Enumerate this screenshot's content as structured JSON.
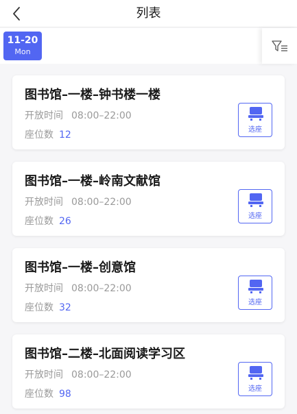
{
  "header": {
    "title": "列表",
    "back_icon": "chevron-left-icon"
  },
  "date_bar": {
    "selected_date": "11-20",
    "selected_weekday": "Mon",
    "accent_color": "#5266f2",
    "filter_icon": "filter-list-icon"
  },
  "labels": {
    "open_time": "开放时间",
    "seats": "座位数",
    "select_seat": "选座"
  },
  "rooms": [
    {
      "name": "图书馆–一楼–钟书楼一楼",
      "hours": "08:00–22:00",
      "seats": "12"
    },
    {
      "name": "图书馆–一楼–岭南文献馆",
      "hours": "08:00–22:00",
      "seats": "26"
    },
    {
      "name": "图书馆–一楼–创意馆",
      "hours": "08:00–22:00",
      "seats": "32"
    },
    {
      "name": "图书馆–二楼–北面阅读学习区",
      "hours": "08:00–22:00",
      "seats": "98"
    }
  ]
}
